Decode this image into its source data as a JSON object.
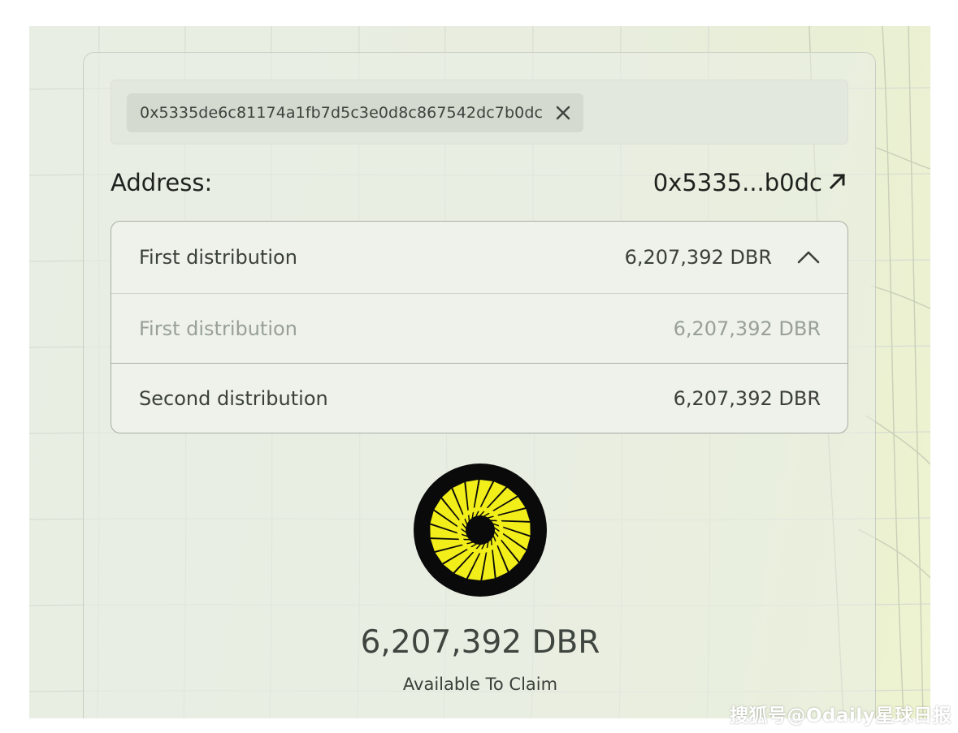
{
  "search": {
    "chip_text": "0x5335de6c81174a1fb7d5c3e0d8c867542dc7b0dc",
    "chip_close_icon": "close-icon"
  },
  "address": {
    "label": "Address:",
    "value": "0x5335...b0dc",
    "link_icon": "arrow-up-right-icon"
  },
  "distributions": {
    "header": {
      "name": "First distribution",
      "amount": "6,207,392 DBR",
      "toggle_icon": "chevron-up-icon"
    },
    "items": [
      {
        "name": "First distribution",
        "amount": "6,207,392 DBR",
        "state": "muted"
      },
      {
        "name": "Second distribution",
        "amount": "6,207,392 DBR",
        "state": "normal"
      }
    ]
  },
  "claim": {
    "logo_icon": "token-logo-icon",
    "total": "6,207,392 DBR",
    "label": "Available To Claim"
  },
  "watermark": {
    "text": "搜狐号@Odaily星球日报"
  },
  "colors": {
    "logo_bg": "#0a0a0a",
    "logo_accent": "#f2ee1a",
    "text_primary": "#1e221e",
    "text_muted": "#98a098"
  }
}
